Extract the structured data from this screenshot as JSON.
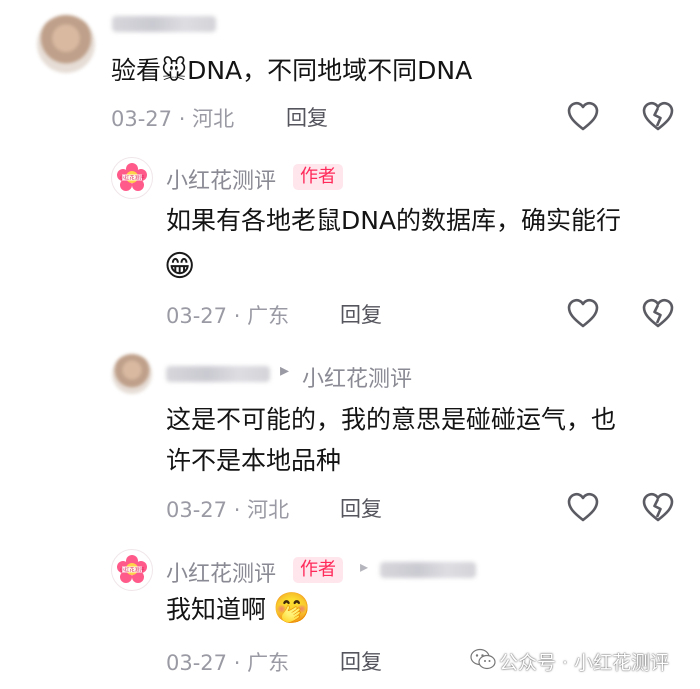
{
  "comments": [
    {
      "text": "验看🐭DNA，不同地域不同DNA",
      "date": "03-27",
      "separator": "·",
      "location": "河北",
      "reply": "回复"
    },
    {
      "name": "小红花测评",
      "badge": "作者",
      "text_line1": "如果有各地老鼠DNA的数据库，确实能行",
      "emoji": "😁",
      "date": "03-27",
      "separator": "·",
      "location": "广东",
      "reply": "回复"
    },
    {
      "reply_arrow": "▸",
      "reply_to": "小红花测评",
      "text_line1": "这是不可能的，我的意思是碰碰运气，也",
      "text_line2": "许不是本地品种",
      "date": "03-27",
      "separator": "·",
      "location": "河北",
      "reply": "回复"
    },
    {
      "name": "小红花测评",
      "badge": "作者",
      "reply_arrow": "▸",
      "text": "我知道啊",
      "emoji": "🤭",
      "date": "03-27",
      "separator": "·",
      "location": "广东",
      "reply": "回复"
    }
  ],
  "watermark": "公众号 · 小红花测评",
  "avatar_flower_text": "小红花测评",
  "colors": {
    "badge": "#ff2a5a",
    "meta": "#9a9aa4",
    "icon": "#5b5b63"
  }
}
